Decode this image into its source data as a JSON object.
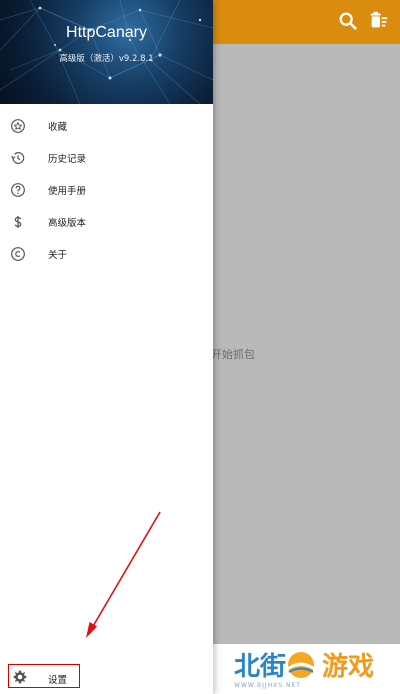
{
  "app_bar": {
    "color": "#d98c0e",
    "icons": [
      "search-icon",
      "clear-list-icon"
    ]
  },
  "main": {
    "hint": "打开始抓包"
  },
  "drawer": {
    "title": "HttpCanary",
    "version": "高级版（激活）v9.2.8.1",
    "items": [
      {
        "label": "收藏",
        "icon": "star-circle-icon"
      },
      {
        "label": "历史记录",
        "icon": "history-icon"
      },
      {
        "label": "使用手册",
        "icon": "help-circle-icon"
      },
      {
        "label": "高级版本",
        "icon": "dollar-icon"
      },
      {
        "label": "关于",
        "icon": "copyright-icon"
      }
    ],
    "settings": {
      "label": "设置",
      "icon": "gear-icon"
    }
  },
  "annotation": {
    "color": "#d40000"
  },
  "watermark": {
    "left": "北街",
    "right": "游戏",
    "url": "WWW.BJJHXS.NET"
  }
}
